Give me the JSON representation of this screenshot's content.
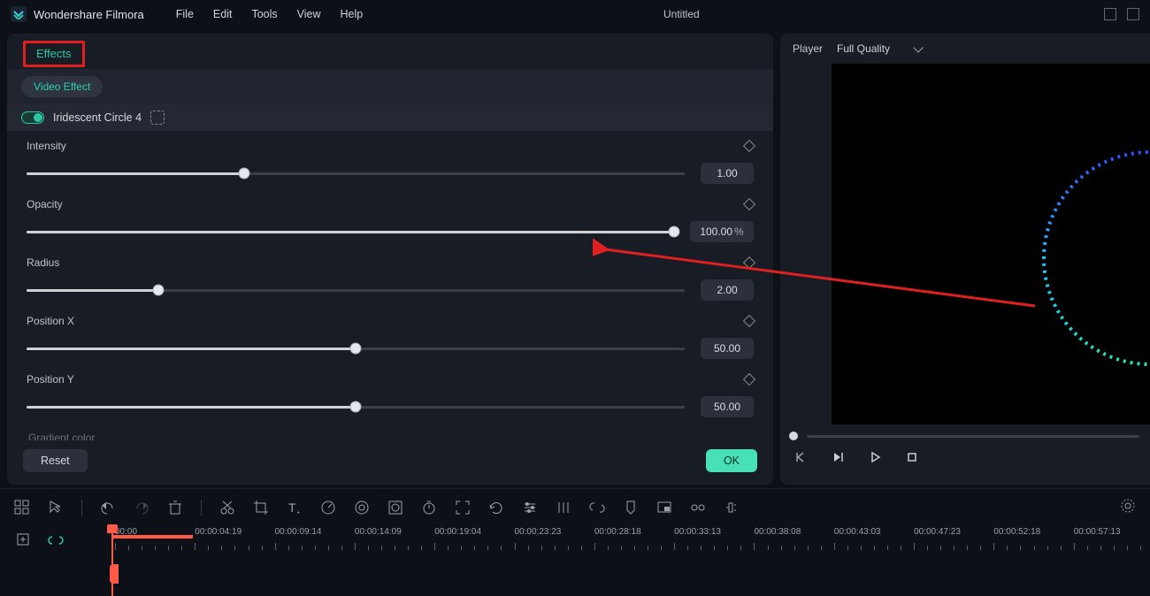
{
  "app": {
    "name": "Wondershare Filmora",
    "document": "Untitled"
  },
  "menu": {
    "file": "File",
    "edit": "Edit",
    "tools": "Tools",
    "view": "View",
    "help": "Help"
  },
  "tabs": {
    "effects": "Effects"
  },
  "subtabs": {
    "video_effect": "Video Effect"
  },
  "effect": {
    "name": "Iridescent Circle 4"
  },
  "params": {
    "intensity": {
      "label": "Intensity",
      "value": "1.00",
      "pct": 33
    },
    "opacity": {
      "label": "Opacity",
      "value": "100.00",
      "unit": "%",
      "pct": 100
    },
    "radius": {
      "label": "Radius",
      "value": "2.00",
      "pct": 20
    },
    "posx": {
      "label": "Position X",
      "value": "50.00",
      "pct": 50
    },
    "posy": {
      "label": "Position Y",
      "value": "50.00",
      "pct": 50
    },
    "cutoff": {
      "label": "Gradient color"
    }
  },
  "buttons": {
    "reset": "Reset",
    "ok": "OK"
  },
  "player": {
    "label": "Player",
    "quality": "Full Quality"
  },
  "timeline": {
    "timecodes": [
      "00:00",
      "00:00:04:19",
      "00:00:09:14",
      "00:00:14:09",
      "00:00:19:04",
      "00:00:23:23",
      "00:00:28:18",
      "00:00:33:13",
      "00:00:38:08",
      "00:00:43:03",
      "00:00:47:23",
      "00:00:52:18",
      "00:00:57:13"
    ]
  }
}
